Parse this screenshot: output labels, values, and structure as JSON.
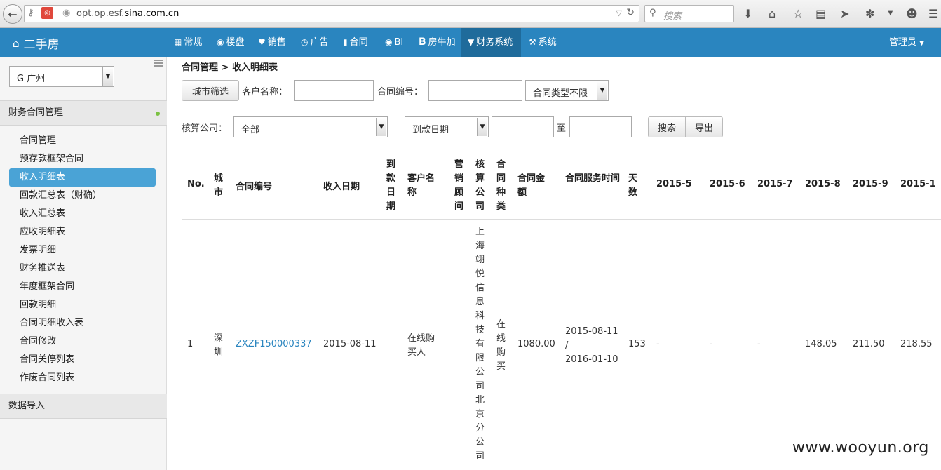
{
  "browser": {
    "url_prefix": "opt.op.esf.",
    "url_domain": "sina.com.cn",
    "search_placeholder": "搜索"
  },
  "topnav": {
    "brand": "二手房",
    "items": [
      {
        "label": "常规",
        "icon": "grid-icon"
      },
      {
        "label": "楼盘",
        "icon": "globe-icon"
      },
      {
        "label": "销售",
        "icon": "heart-icon"
      },
      {
        "label": "广告",
        "icon": "clock-icon"
      },
      {
        "label": "合同",
        "icon": "file-icon"
      },
      {
        "label": "BI",
        "icon": "eye-icon"
      },
      {
        "label": "房牛加",
        "icon": "b-icon"
      },
      {
        "label": "财务系统",
        "icon": "filter-icon"
      },
      {
        "label": "系统",
        "icon": "wrench-icon"
      }
    ],
    "active": "财务系统",
    "admin": "管理员"
  },
  "sidebar": {
    "city": "G 广州",
    "section_finance": "财务合同管理",
    "items": [
      "合同管理",
      "预存款框架合同",
      "收入明细表",
      "回款汇总表（财确）",
      "收入汇总表",
      "应收明细表",
      "发票明细",
      "财务推送表",
      "年度框架合同",
      "回款明细",
      "合同明细收入表",
      "合同修改",
      "合同关停列表",
      "作废合同列表"
    ],
    "active_item": "收入明细表",
    "section_import": "数据导入"
  },
  "filters": {
    "breadcrumb": "合同管理 > 收入明细表",
    "city_filter_btn": "城市筛选",
    "customer_name_label": "客户名称：",
    "contract_no_label": "合同编号：",
    "contract_type_select": "合同类型不限",
    "company_label": "核算公司：",
    "company_select": "全部",
    "date_type_select": "到款日期",
    "to_label": "至",
    "search_btn": "搜索",
    "export_btn": "导出"
  },
  "table": {
    "headers": {
      "no": "No.",
      "city": "城市",
      "contract_no": "合同编号",
      "income_date": "收入日期",
      "arrival_date": "到款日期",
      "customer_name": "客户名称",
      "sales_advisor": "营销顾问",
      "accounting_company": "核算公司",
      "contract_type": "合同种类",
      "amount": "合同金额",
      "service_period": "合同服务时间",
      "days": "天数",
      "m2015_5": "2015-5",
      "m2015_6": "2015-6",
      "m2015_7": "2015-7",
      "m2015_8": "2015-8",
      "m2015_9": "2015-9",
      "m2015_10": "2015-1"
    },
    "rows": [
      {
        "no": "1",
        "city": "深圳",
        "contract_no": "ZXZF150000337",
        "income_date": "2015-08-11",
        "arrival_date": "",
        "customer_name": "在线购买人",
        "sales_advisor": "",
        "accounting_company": "上海翊悦信息科技有限公司北京分公司",
        "contract_type": "在线购买",
        "amount": "1080.00",
        "service_start": "2015-08-11",
        "service_sep": "/",
        "service_end": "2016-01-10",
        "days": "153",
        "m2015_5": "-",
        "m2015_6": "-",
        "m2015_7": "-",
        "m2015_8": "148.05",
        "m2015_9": "211.50",
        "m2015_10": "218.55"
      }
    ]
  },
  "watermark": "www.wooyun.org"
}
